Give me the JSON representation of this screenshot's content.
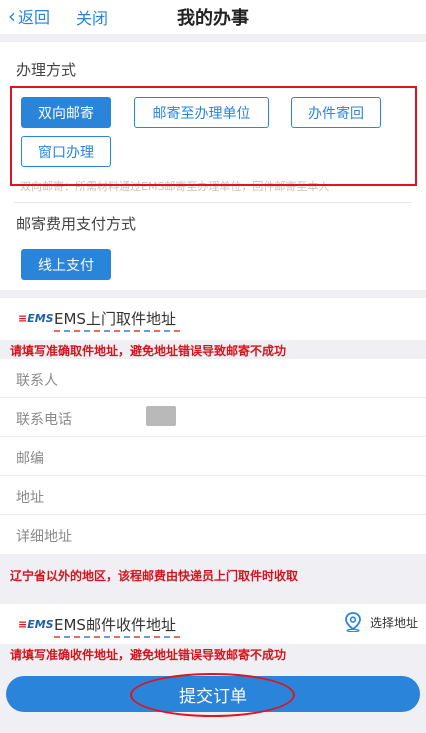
{
  "nav": {
    "back_label": "返回",
    "close_label": "关闭",
    "title": "我的办事"
  },
  "handling": {
    "title": "办理方式",
    "options": [
      "双向邮寄",
      "邮寄至办理单位",
      "办件寄回",
      "窗口办理"
    ],
    "note": "双向邮寄：所需材料通过EMS邮寄至办理单位，回件邮寄至本人"
  },
  "payment": {
    "title": "邮寄费用支付方式",
    "option": "线上支付"
  },
  "pickup": {
    "logo": "EMS",
    "title": "EMS上门取件地址",
    "warning": "请填写准确取件地址，避免地址错误导致邮寄不成功",
    "fields": [
      "联系人",
      "联系电话",
      "邮编",
      "地址",
      "详细地址"
    ],
    "footer_warning": "辽宁省以外的地区，该程邮费由快递员上门取件时收取"
  },
  "receive": {
    "logo": "EMS",
    "title": "EMS邮件收件地址",
    "select_label": "选择地址",
    "warning": "请填写准确收件地址，避免地址错误导致邮寄不成功"
  },
  "submit_label": "提交订单",
  "colors": {
    "accent": "#2a84d9",
    "annotation_red": "#e0141e",
    "warning_text": "#d4141c"
  },
  "icons": {
    "back": "chevron-left-icon",
    "location": "location-pin-icon",
    "ems": "ems-logo"
  }
}
